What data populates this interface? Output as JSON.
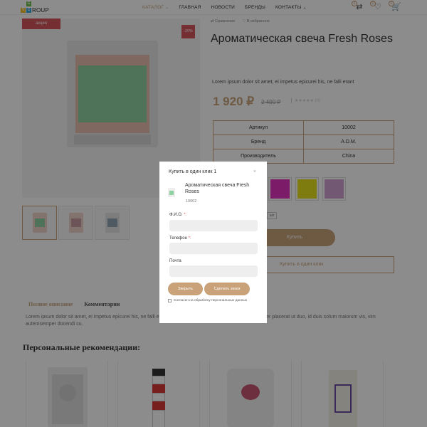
{
  "header": {
    "logo_letters": [
      "V",
      "G",
      "C"
    ],
    "logo_text": "ROUP",
    "nav": [
      {
        "label": "КАТАЛОГ",
        "active": true,
        "has_dropdown": true
      },
      {
        "label": "ГЛАВНАЯ",
        "active": false,
        "has_dropdown": false
      },
      {
        "label": "НОВОСТИ",
        "active": false,
        "has_dropdown": false
      },
      {
        "label": "БРЕНДЫ",
        "active": false,
        "has_dropdown": false
      },
      {
        "label": "КОНТАКТЫ",
        "active": false,
        "has_dropdown": true
      }
    ],
    "icons": [
      {
        "name": "compare-icon",
        "count": "0"
      },
      {
        "name": "wishlist-icon",
        "count": "0"
      },
      {
        "name": "cart-icon",
        "count": "0"
      }
    ]
  },
  "product": {
    "badge_sale": "акция",
    "badge_discount": "-20%",
    "compare_label": "Сравнение",
    "wishlist_label": "В избранное",
    "title": "Ароматическая свеча Fresh Roses",
    "short_desc": "Lorem ipsum dolor sit amet, ei impetus epicurei his, ne falli erant",
    "price": "1 920 ₽",
    "old_price": "2 400 ₽",
    "rating": "★★★★★ (0)",
    "specs": [
      {
        "label": "Артикул",
        "value": "10002"
      },
      {
        "label": "Бренд",
        "value": "A.D.M."
      },
      {
        "label": "Производитель",
        "value": "China"
      }
    ],
    "swatch_colors": [
      "#e233c0",
      "#e6e21c",
      "#cfa0cf"
    ],
    "qty_unit": "шт",
    "buy_label": "Купить",
    "oneclick_label": "Купить в один клик"
  },
  "tabs": [
    {
      "label": "Полное описание",
      "active": true
    },
    {
      "label": "Комментарии",
      "active": false
    }
  ],
  "description": "Lorem ipsum dolor sit amet, ei impetus epicurei his, ne falli erant ... an, an rebum regione ponderum mel. Facer placerat ut duo, id duis solum maiorum vis, vim autemsemper docendi cu.",
  "recommendations": {
    "title": "Персональные рекомендации:"
  },
  "modal": {
    "title": "Купить в один клик 1",
    "close": "×",
    "product_name": "Ароматическая свеча Fresh Roses",
    "product_code": "10002",
    "fields": [
      {
        "label": "Ф.И.О.",
        "required": true,
        "value": ""
      },
      {
        "label": "Телефон",
        "required": true,
        "value": ""
      },
      {
        "label": "Почта",
        "required": false,
        "value": ""
      }
    ],
    "close_button": "Закрыть",
    "submit_button": "Сделать заказ",
    "consent": "Согласен на обработку персональных данных"
  },
  "colors": {
    "accent": "#c9a27a",
    "sale": "#d6545b",
    "overlay": "rgba(0,0,0,0.45)"
  }
}
